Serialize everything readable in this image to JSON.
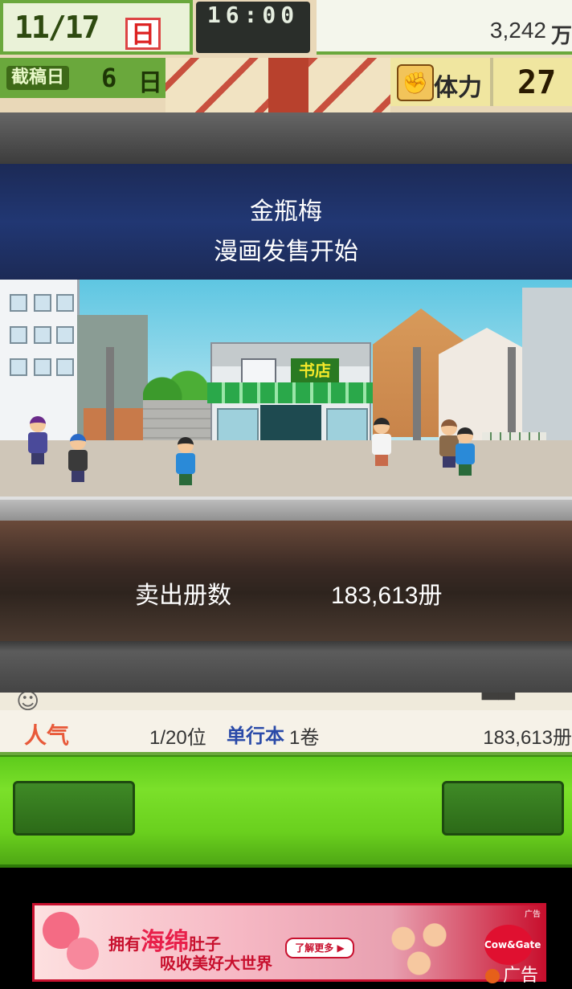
{
  "hud": {
    "date": "11/17",
    "day_of_week": "日",
    "clock": "16:00",
    "money": "3,242",
    "money_unit": "万",
    "deadline_label": "截稿日",
    "deadline_days": "6",
    "deadline_unit": "日",
    "stamina_label": "体力",
    "stamina_value": "27"
  },
  "modal": {
    "manga_title": "金瓶梅",
    "event_text": "漫画发售开始",
    "shop_sign": "书店",
    "sold_label": "卖出册数",
    "sold_value": "183,613册"
  },
  "panel": {
    "popularity_label": "人气",
    "rank": "1/20位",
    "volumes_label": "单行本",
    "volumes": "1卷",
    "sales": "183,613册"
  },
  "ad": {
    "line1_prefix": "拥有",
    "line1_highlight": "海绵",
    "line1_suffix": "肚子",
    "line2": "吸收美好大世界",
    "more_button": "了解更多 ▶",
    "brand": "Cow&Gate",
    "ad_label": "广告"
  },
  "colors": {
    "accent_green": "#6aa83c",
    "title_band": "#213773",
    "ad_red": "#c8102e"
  }
}
